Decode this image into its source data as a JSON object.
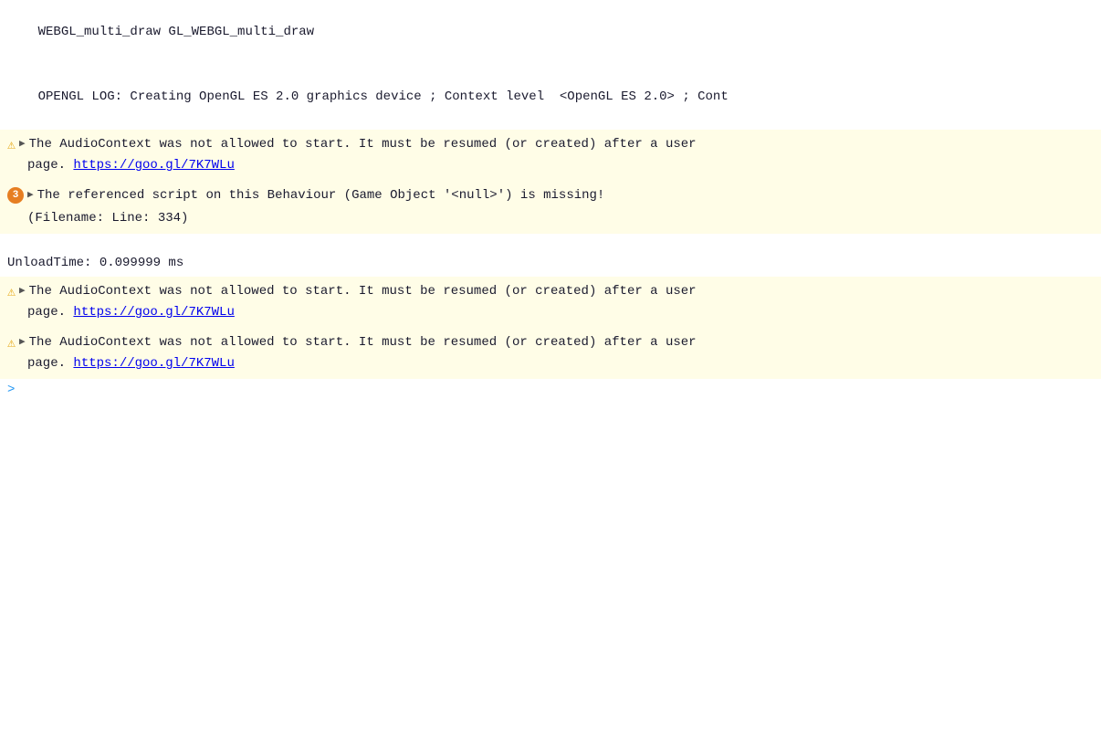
{
  "console": {
    "lines": [
      {
        "type": "plain",
        "text": "WEBGL_multi_draw GL_WEBGL_multi_draw"
      },
      {
        "type": "opengl",
        "text": "OPENGL LOG: Creating OpenGL ES 2.0 graphics device ; Context level  <OpenGL ES 2.0> ; Cont"
      }
    ],
    "warning1": {
      "type": "warning",
      "main_text": "The AudioContext was not allowed to start. It must be resumed (or created) after a user",
      "continuation": "page.",
      "link_text": "https://goo.gl/7K7WLu",
      "link_url": "https://goo.gl/7K7WLu"
    },
    "error1": {
      "type": "error",
      "badge": "3",
      "main_text": "The referenced script on this Behaviour (Game Object '<null>') is missing!",
      "continuation": "(Filename:  Line: 334)"
    },
    "unload": {
      "text": "UnloadTime: 0.099999 ms"
    },
    "warning2": {
      "type": "warning",
      "main_text": "The AudioContext was not allowed to start. It must be resumed (or created) after a user",
      "continuation": "page.",
      "link_text": "https://goo.gl/7K7WLu",
      "link_url": "https://goo.gl/7K7WLu"
    },
    "warning3": {
      "type": "warning",
      "main_text": "The AudioContext was not allowed to start. It must be resumed (or created) after a user",
      "continuation": "page.",
      "link_text": "https://goo.gl/7K7WLu",
      "link_url": "https://goo.gl/7K7WLu"
    },
    "prompt": {
      "symbol": ">"
    }
  }
}
